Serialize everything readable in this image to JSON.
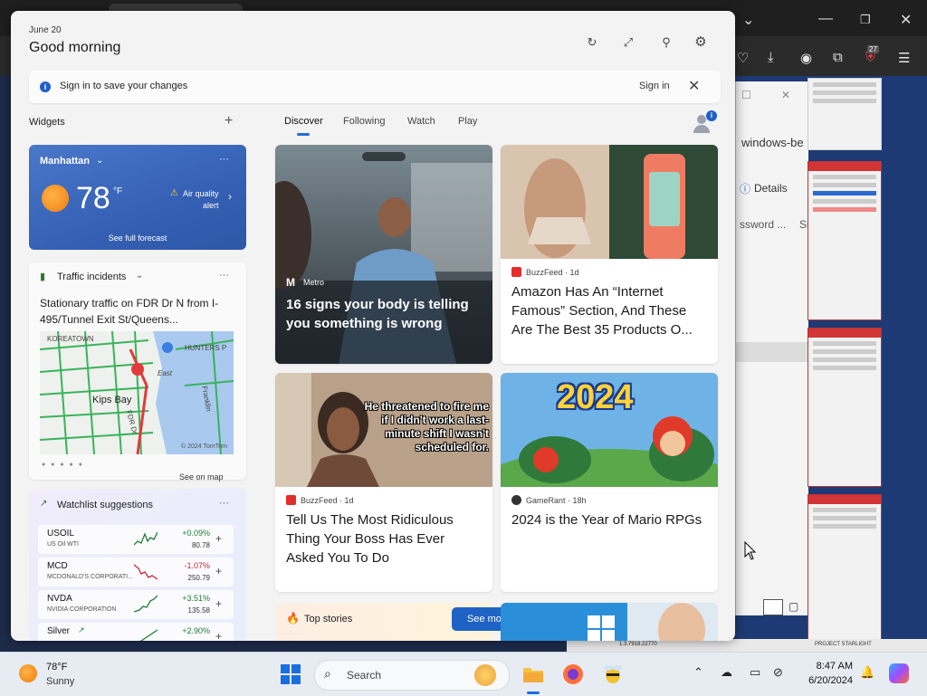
{
  "panel": {
    "date": "June 20",
    "greeting": "Good morning",
    "signin_text": "Sign in to save your changes",
    "signin_link": "Sign in",
    "widgets_label": "Widgets",
    "tabs": [
      {
        "label": "Discover"
      },
      {
        "label": "Following"
      },
      {
        "label": "Watch"
      },
      {
        "label": "Play"
      }
    ],
    "profile_badge": "i"
  },
  "weather": {
    "location": "Manhattan",
    "temp": "78",
    "unit": "°F",
    "alert_line1": "Air quality",
    "alert_line2": "alert",
    "forecast": "See full forecast"
  },
  "traffic": {
    "title": "Traffic incidents",
    "desc": "Stationary traffic on FDR Dr N from I-495/Tunnel Exit St/Queens...",
    "map_labels": [
      "KOREATOWN",
      "HUNTERS P",
      "Kips Bay",
      "East",
      "© 2024 TomTom",
      "Franklin",
      "FDR Dr"
    ],
    "see_on_map": "See on map"
  },
  "watchlist": {
    "title": "Watchlist suggestions",
    "stocks": [
      {
        "symbol": "USOIL",
        "name": "US Oil WTI",
        "change": "+0.09%",
        "price": "80.78",
        "dir": "up"
      },
      {
        "symbol": "MCD",
        "name": "MCDONALD'S CORPORATI...",
        "change": "-1.07%",
        "price": "250.79",
        "dir": "down"
      },
      {
        "symbol": "NVDA",
        "name": "NVIDIA CORPORATION",
        "change": "+3.51%",
        "price": "135.58",
        "dir": "up"
      },
      {
        "symbol": "Silver",
        "name": "",
        "change": "+2.90%",
        "price": "",
        "dir": "up"
      }
    ]
  },
  "feed": {
    "hero": {
      "source": "Metro",
      "headline": "16 signs your body is telling you something is wrong"
    },
    "card2": {
      "source": "BuzzFeed · 1d",
      "headline": "Amazon Has An “Internet Famous” Section, And These Are The Best 35 Products O..."
    },
    "card3": {
      "source": "BuzzFeed · 1d",
      "headline": "Tell Us The Most Ridiculous Thing Your Boss Has Ever Asked You To Do",
      "image_caption": "He threatened to fire me if I didn't work a last-minute shift I wasn't scheduled for."
    },
    "card4": {
      "source": "GameRant · 18h",
      "headline": "2024 is the Year of Mario RPGs",
      "image_text": "2024"
    },
    "top_stories": "Top stories",
    "see_more": "See more"
  },
  "background": {
    "browser_badge": "27",
    "dialog_text1": "windows-be",
    "dialog_details": "Details",
    "dialog_text2": "ssword ...",
    "dialog_text3": "Si",
    "strip_text1": "1.3.7918.22770",
    "strip_text2": "PROJECT STARLIGHT"
  },
  "taskbar": {
    "temp": "78°F",
    "condition": "Sunny",
    "search": "Search",
    "time": "8:47 AM",
    "date": "6/20/2024"
  },
  "colors": {
    "accent": "#1e63c4",
    "up": "#1e7d33",
    "down": "#c4263a"
  }
}
